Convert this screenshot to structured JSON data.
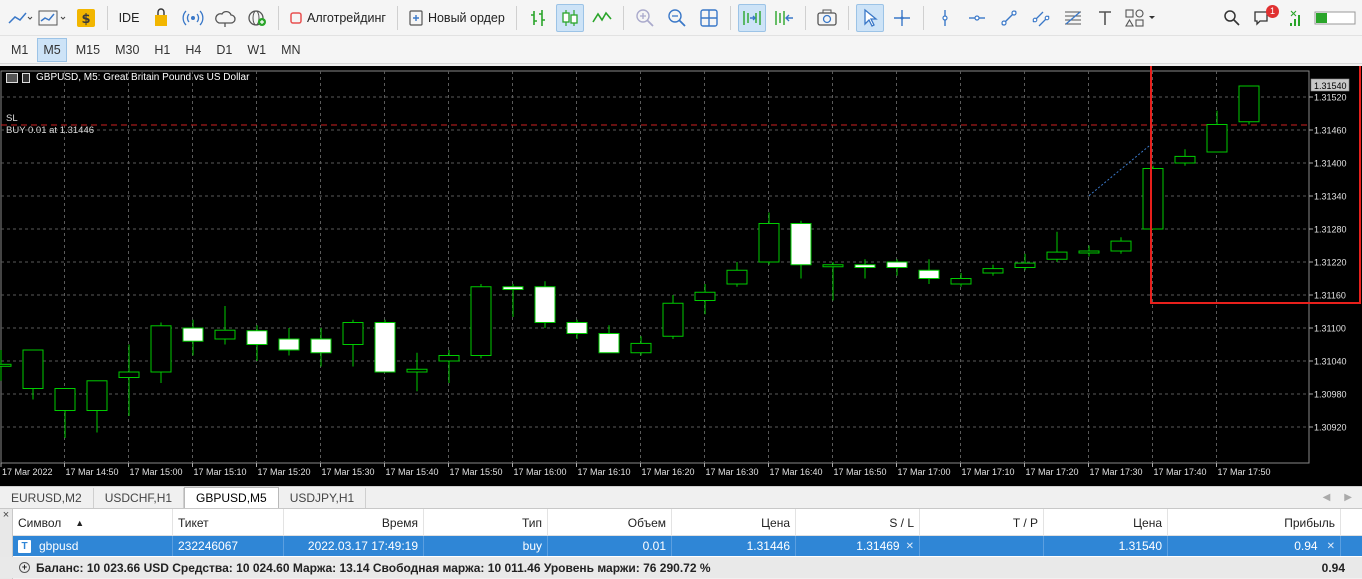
{
  "toolbar": {
    "ide_label": "IDE",
    "algo_label": "Алготрейдинг",
    "new_order_label": "Новый ордер",
    "notification_count": "1",
    "algo_status_color": "#e85050",
    "buy_color": "#2aa52a"
  },
  "timeframes": [
    {
      "label": "M1",
      "active": false
    },
    {
      "label": "M5",
      "active": true
    },
    {
      "label": "M15",
      "active": false
    },
    {
      "label": "M30",
      "active": false
    },
    {
      "label": "H1",
      "active": false
    },
    {
      "label": "H4",
      "active": false
    },
    {
      "label": "D1",
      "active": false
    },
    {
      "label": "W1",
      "active": false
    },
    {
      "label": "MN",
      "active": false
    }
  ],
  "chart": {
    "title": "GBPUSD, M5:  Great Britain Pound vs US Dollar",
    "sl_label": "SL",
    "order_label": "BUY 0.01 at 1.31446",
    "price_current": "1.31540",
    "sl_price": 1.31469,
    "order_price": 1.31446,
    "current_price": 1.3154,
    "background": "#000000",
    "candle_color": "#00cc00",
    "candle_body_color": "#ffffff",
    "grid_color": "#5a5a5a",
    "sl_line_color": "#cc2020",
    "highlight_box_color": "#e8201c",
    "price_ticks": [
      "1.31520",
      "1.31460",
      "1.31400",
      "1.31340",
      "1.31280",
      "1.31220",
      "1.31160",
      "1.31100",
      "1.31040",
      "1.30980",
      "1.30920"
    ],
    "time_labels": [
      "17 Mar 2022",
      "17 Mar 14:50",
      "17 Mar 15:00",
      "17 Mar 15:10",
      "17 Mar 15:20",
      "17 Mar 15:30",
      "17 Mar 15:40",
      "17 Mar 15:50",
      "17 Mar 16:00",
      "17 Mar 16:10",
      "17 Mar 16:20",
      "17 Mar 16:30",
      "17 Mar 16:40",
      "17 Mar 16:50",
      "17 Mar 17:00",
      "17 Mar 17:10",
      "17 Mar 17:20",
      "17 Mar 17:30",
      "17 Mar 17:40",
      "17 Mar 17:50"
    ]
  },
  "chart_data": {
    "type": "candlestick",
    "title": "GBPUSD, M5:  Great Britain Pound vs US Dollar",
    "ylim": [
      1.3088,
      1.3156
    ],
    "candles": [
      {
        "o": 1.31034,
        "h": 1.3106,
        "l": 1.31004,
        "c": 1.31034
      },
      {
        "o": 1.3099,
        "h": 1.3106,
        "l": 1.3097,
        "c": 1.3106
      },
      {
        "o": 1.3095,
        "h": 1.3099,
        "l": 1.309,
        "c": 1.3099
      },
      {
        "o": 1.3095,
        "h": 1.31004,
        "l": 1.3091,
        "c": 1.31004
      },
      {
        "o": 1.3101,
        "h": 1.3107,
        "l": 1.3094,
        "c": 1.3102
      },
      {
        "o": 1.3102,
        "h": 1.3111,
        "l": 1.31,
        "c": 1.31104
      },
      {
        "o": 1.311,
        "h": 1.31115,
        "l": 1.3105,
        "c": 1.31076
      },
      {
        "o": 1.3108,
        "h": 1.3114,
        "l": 1.3107,
        "c": 1.31096
      },
      {
        "o": 1.31095,
        "h": 1.31105,
        "l": 1.3104,
        "c": 1.3107
      },
      {
        "o": 1.3108,
        "h": 1.311,
        "l": 1.3105,
        "c": 1.3106
      },
      {
        "o": 1.3108,
        "h": 1.311,
        "l": 1.3103,
        "c": 1.31055
      },
      {
        "o": 1.3107,
        "h": 1.31115,
        "l": 1.3103,
        "c": 1.3111
      },
      {
        "o": 1.3111,
        "h": 1.31115,
        "l": 1.3102,
        "c": 1.3102
      },
      {
        "o": 1.3102,
        "h": 1.31055,
        "l": 1.30985,
        "c": 1.31025
      },
      {
        "o": 1.3104,
        "h": 1.3106,
        "l": 1.31,
        "c": 1.3105
      },
      {
        "o": 1.3105,
        "h": 1.3118,
        "l": 1.31045,
        "c": 1.31175
      },
      {
        "o": 1.31175,
        "h": 1.3118,
        "l": 1.3112,
        "c": 1.3117
      },
      {
        "o": 1.31175,
        "h": 1.31185,
        "l": 1.311,
        "c": 1.3111
      },
      {
        "o": 1.3111,
        "h": 1.31115,
        "l": 1.3108,
        "c": 1.3109
      },
      {
        "o": 1.3109,
        "h": 1.31105,
        "l": 1.31055,
        "c": 1.31055
      },
      {
        "o": 1.31055,
        "h": 1.31085,
        "l": 1.3105,
        "c": 1.31072
      },
      {
        "o": 1.31085,
        "h": 1.3116,
        "l": 1.3108,
        "c": 1.31145
      },
      {
        "o": 1.3115,
        "h": 1.3118,
        "l": 1.31125,
        "c": 1.31165
      },
      {
        "o": 1.3118,
        "h": 1.3122,
        "l": 1.31175,
        "c": 1.31205
      },
      {
        "o": 1.3122,
        "h": 1.3131,
        "l": 1.31215,
        "c": 1.3129
      },
      {
        "o": 1.3129,
        "h": 1.31295,
        "l": 1.3119,
        "c": 1.31215
      },
      {
        "o": 1.31215,
        "h": 1.3122,
        "l": 1.3115,
        "c": 1.31215
      },
      {
        "o": 1.31215,
        "h": 1.31225,
        "l": 1.3119,
        "c": 1.3121
      },
      {
        "o": 1.3122,
        "h": 1.31225,
        "l": 1.31195,
        "c": 1.3121
      },
      {
        "o": 1.31205,
        "h": 1.31225,
        "l": 1.3118,
        "c": 1.3119
      },
      {
        "o": 1.3118,
        "h": 1.312,
        "l": 1.31175,
        "c": 1.3119
      },
      {
        "o": 1.312,
        "h": 1.31215,
        "l": 1.31195,
        "c": 1.31208
      },
      {
        "o": 1.3121,
        "h": 1.31235,
        "l": 1.31205,
        "c": 1.31218
      },
      {
        "o": 1.31225,
        "h": 1.31275,
        "l": 1.3122,
        "c": 1.31238
      },
      {
        "o": 1.31238,
        "h": 1.3125,
        "l": 1.3123,
        "c": 1.3124
      },
      {
        "o": 1.3124,
        "h": 1.31265,
        "l": 1.31235,
        "c": 1.31258
      },
      {
        "o": 1.3128,
        "h": 1.31395,
        "l": 1.3128,
        "c": 1.3139
      },
      {
        "o": 1.314,
        "h": 1.31425,
        "l": 1.31395,
        "c": 1.31412
      },
      {
        "o": 1.3142,
        "h": 1.31495,
        "l": 1.3142,
        "c": 1.3147
      },
      {
        "o": 1.31475,
        "h": 1.3154,
        "l": 1.3147,
        "c": 1.3154
      }
    ]
  },
  "chart_tabs": [
    {
      "label": "EURUSD,M2",
      "active": false
    },
    {
      "label": "USDCHF,H1",
      "active": false
    },
    {
      "label": "GBPUSD,M5",
      "active": true
    },
    {
      "label": "USDJPY,H1",
      "active": false
    }
  ],
  "terminal": {
    "close_x": "×",
    "columns": [
      {
        "label": "Символ",
        "width": 160,
        "align": "left"
      },
      {
        "label": "Тикет",
        "width": 111,
        "align": "left"
      },
      {
        "label": "Время",
        "width": 140,
        "align": "right"
      },
      {
        "label": "Тип",
        "width": 124,
        "align": "right"
      },
      {
        "label": "Объем",
        "width": 124,
        "align": "right"
      },
      {
        "label": "Цена",
        "width": 124,
        "align": "right"
      },
      {
        "label": "S / L",
        "width": 124,
        "align": "right"
      },
      {
        "label": "T / P",
        "width": 124,
        "align": "right"
      },
      {
        "label": "Цена",
        "width": 124,
        "align": "right"
      },
      {
        "label": "Прибыль",
        "width": 173,
        "align": "right"
      }
    ],
    "row": {
      "symbol": "gbpusd",
      "ticket": "232246067",
      "time": "2022.03.17 17:49:19",
      "type": "buy",
      "volume": "0.01",
      "price_open": "1.31446",
      "sl": "1.31469",
      "tp": "",
      "price_current": "1.31540",
      "profit": "0.94"
    },
    "status": {
      "text": "Баланс: 10 023.66 USD  Средства: 10 024.60  Маржа: 13.14  Свободная маржа: 10 011.46  Уровень маржи: 76 290.72 %",
      "total": "0.94"
    }
  }
}
